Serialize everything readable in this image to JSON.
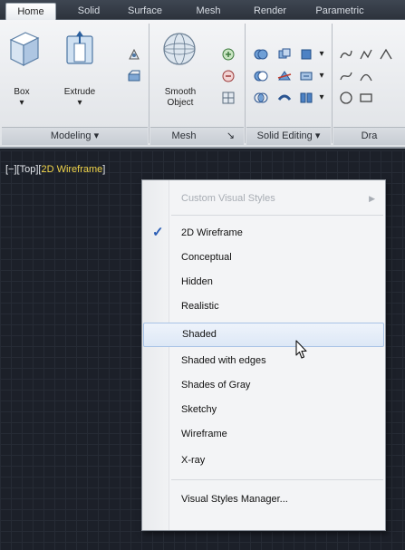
{
  "ribbon": {
    "tabs": [
      {
        "label": "Home",
        "active": true
      },
      {
        "label": "Solid"
      },
      {
        "label": "Surface"
      },
      {
        "label": "Mesh"
      },
      {
        "label": "Render"
      },
      {
        "label": "Parametric"
      }
    ],
    "buttons": {
      "box": "Box",
      "extrude": "Extrude",
      "smooth_object_1": "Smooth",
      "smooth_object_2": "Object"
    },
    "panels": {
      "modeling": "Modeling ▾",
      "mesh": "Mesh",
      "mesh_launcher": "↘",
      "solid_editing": "Solid Editing ▾",
      "draw": "Dra"
    }
  },
  "viewport": {
    "label_prefix": "[−][Top][",
    "label_selected": "2D Wireframe",
    "label_suffix": "]"
  },
  "context_menu": {
    "header": "Custom Visual Styles",
    "items": [
      {
        "label": "2D Wireframe",
        "checked": true
      },
      {
        "label": "Conceptual"
      },
      {
        "label": "Hidden"
      },
      {
        "label": "Realistic"
      },
      {
        "label": "Shaded",
        "hover": true
      },
      {
        "label": "Shaded with edges"
      },
      {
        "label": "Shades of Gray"
      },
      {
        "label": "Sketchy"
      },
      {
        "label": "Wireframe"
      },
      {
        "label": "X-ray"
      }
    ],
    "footer": "Visual Styles Manager..."
  },
  "icons": {
    "check": "checkmark-icon",
    "submenu_arrow": "chevron-right-icon",
    "cursor": "mouse-pointer-icon"
  },
  "colors": {
    "viewport_bg": "#1c2029",
    "selected_style": "#f2d64b",
    "checkmark": "#2a5db5",
    "hover_border": "#a8c3e6"
  }
}
